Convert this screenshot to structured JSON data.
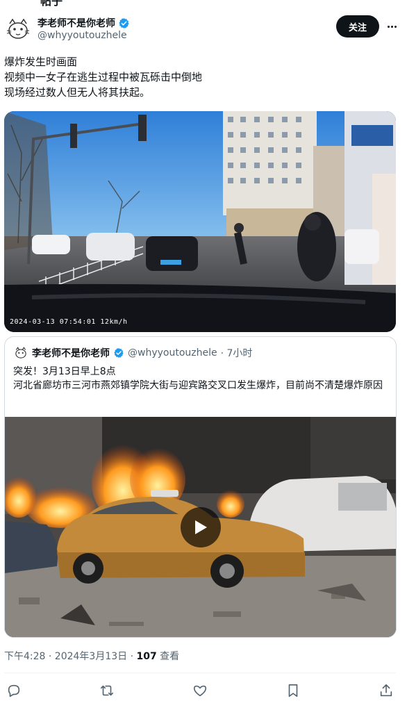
{
  "top_cut_text": "帖子",
  "author": {
    "display_name": "李老师不是你老师",
    "handle": "@whyyoutouzhele",
    "verified": true
  },
  "follow_label": "关注",
  "tweet_lines": [
    "爆炸发生时画面",
    "视频中一女子在逃生过程中被瓦砾击中倒地",
    "现场经过数人但无人将其扶起。"
  ],
  "dashcam_timestamp": "2024-03-13  07:54:01  12km/h",
  "quote": {
    "display_name": "李老师不是你老师",
    "handle": "@whyyoutouzhele",
    "time": "· 7小时",
    "lines": [
      "突发！3月13日早上8点",
      "河北省廊坊市三河市燕郊镇学院大街与迎宾路交叉口发生爆炸，目前尚不清楚爆炸原因"
    ]
  },
  "meta": {
    "time_date": "下午4:28 · 2024年3月13日 · ",
    "views_count": "107",
    "views_label": " 查看"
  },
  "colors": {
    "text": "#0f1419",
    "secondary": "#536471",
    "verified_blue": "#1d9bf0",
    "border": "#cfd9de"
  },
  "icons": [
    "reply-icon",
    "retweet-icon",
    "like-icon",
    "bookmark-icon",
    "share-icon",
    "play-icon",
    "verified-icon",
    "more-icon"
  ]
}
